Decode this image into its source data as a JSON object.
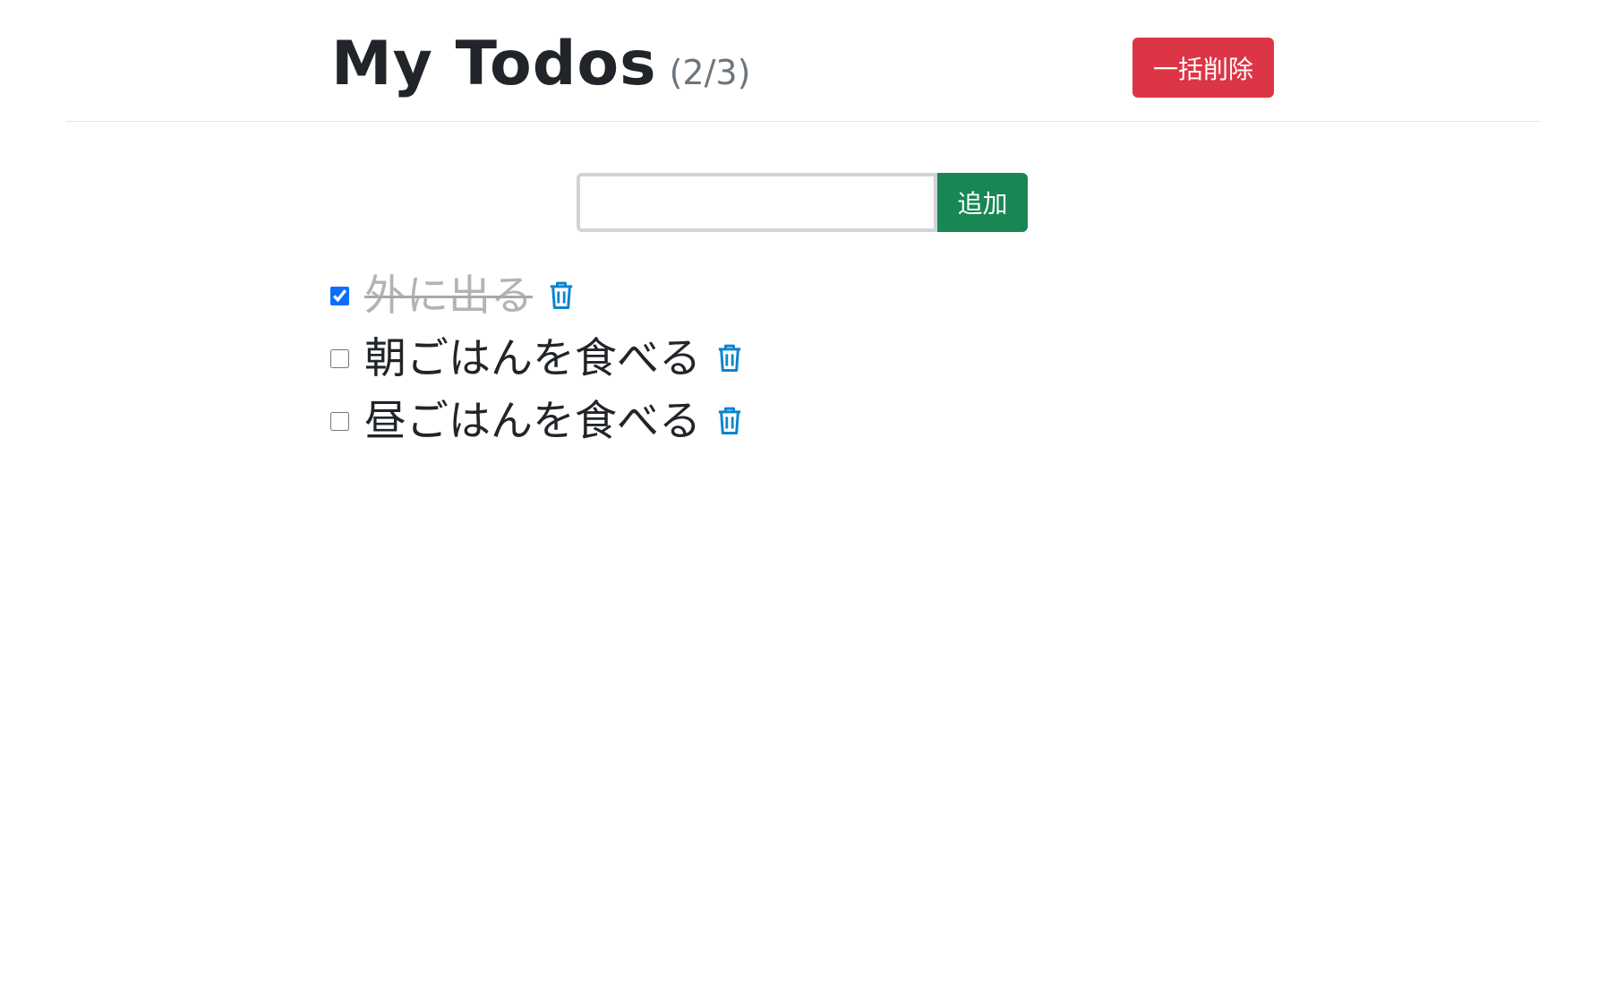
{
  "header": {
    "title": "My Todos",
    "count": "(2/3)",
    "bulk_delete_label": "一括削除"
  },
  "add_form": {
    "input_value": "",
    "input_placeholder": "",
    "add_label": "追加"
  },
  "todos": [
    {
      "text": "外に出る",
      "done": true
    },
    {
      "text": "朝ごはんを食べる",
      "done": false
    },
    {
      "text": "昼ごはんを食べる",
      "done": false
    }
  ],
  "icons": {
    "delete": "trash-icon"
  },
  "colors": {
    "danger": "#dc3545",
    "success": "#198754",
    "primary": "#0d6efd",
    "trash_icon": "#0d84cf",
    "done_text": "#b3b3b3",
    "muted": "#6c757d"
  }
}
